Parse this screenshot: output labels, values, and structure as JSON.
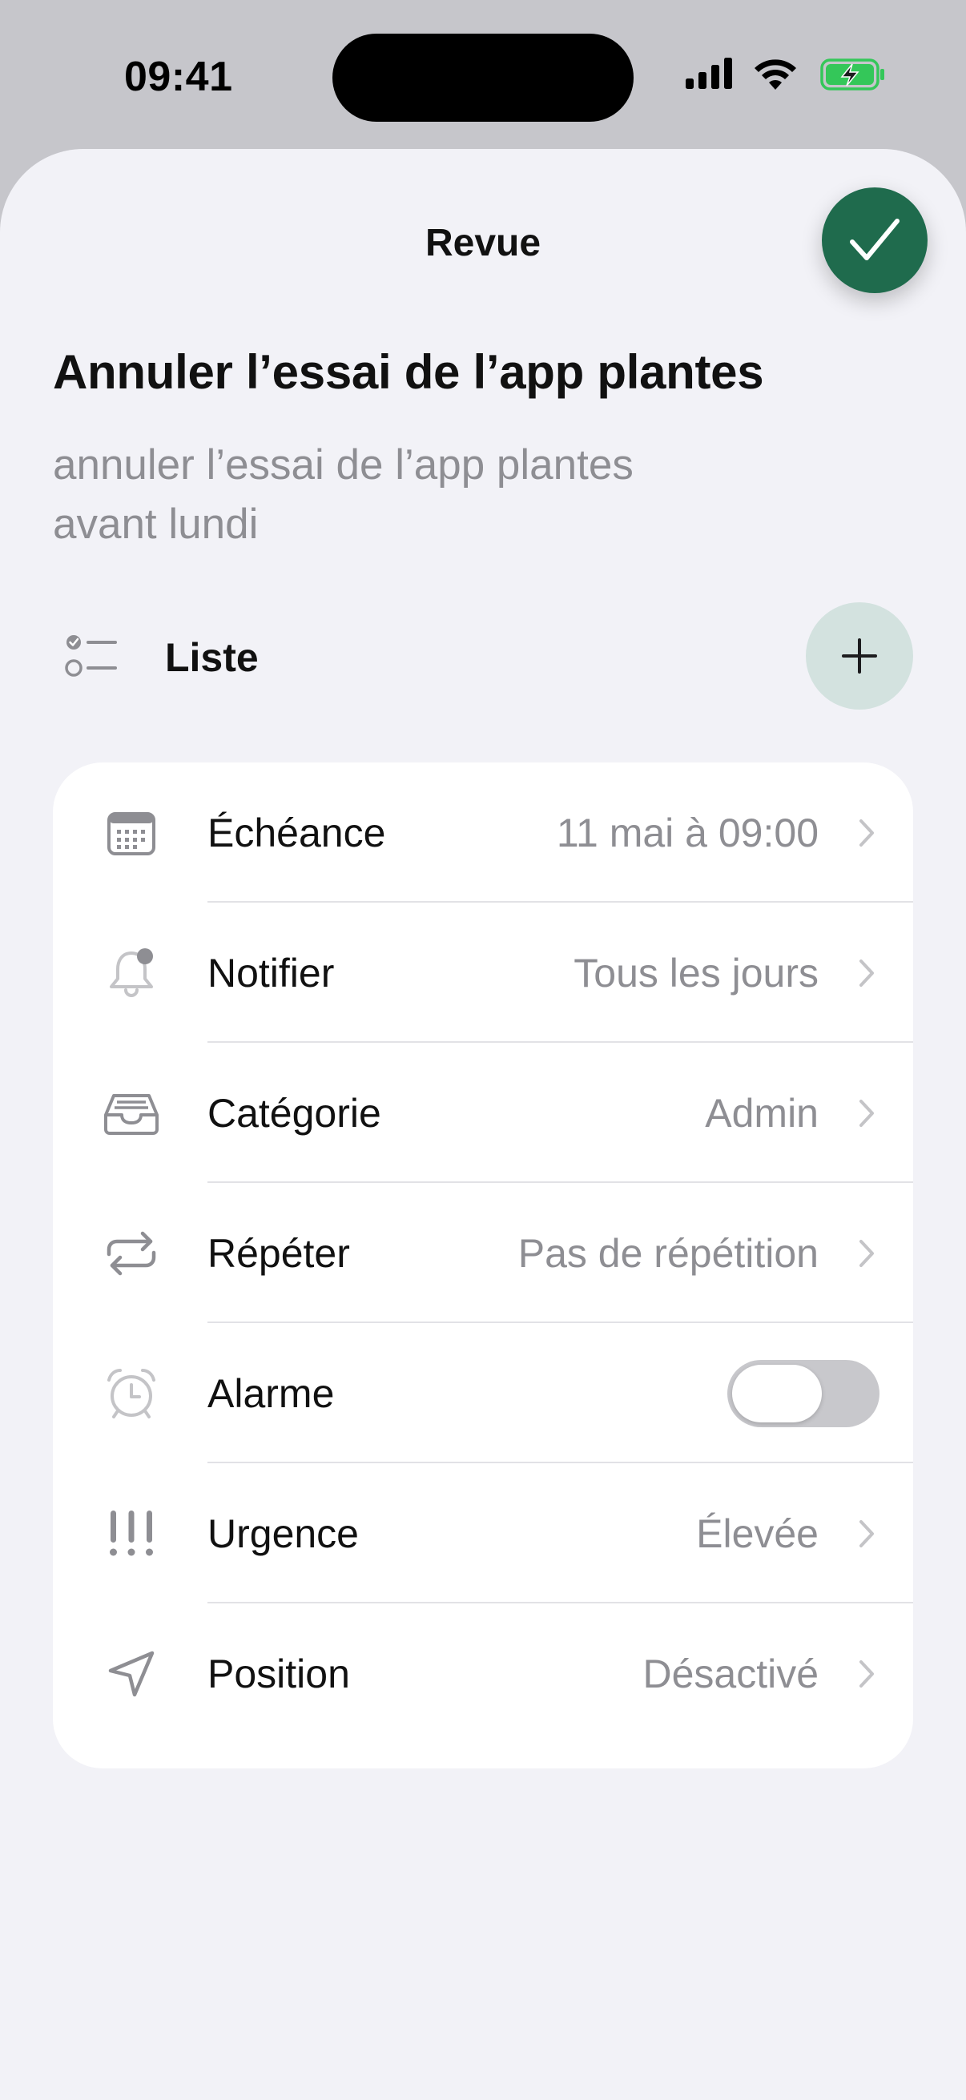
{
  "status_bar": {
    "time": "09:41",
    "icons": [
      "cellular-signal-icon",
      "wifi-icon",
      "battery-charging-icon"
    ],
    "battery_color": "#34c759"
  },
  "sheet": {
    "title": "Revue",
    "confirm_icon": "checkmark-icon",
    "accent_color": "#1f6b4d"
  },
  "task": {
    "title": "Annuler l’essai de l’app plantes",
    "description_line1": "annuler l’essai de l’app plantes",
    "description_line2": "avant lundi"
  },
  "checklist": {
    "label": "Liste",
    "icon": "checklist-icon",
    "add_icon": "plus-icon"
  },
  "details": {
    "due": {
      "label": "Échéance",
      "value": "11 mai à 09:00",
      "icon": "calendar-icon"
    },
    "notify": {
      "label": "Notifier",
      "value": "Tous les jours",
      "icon": "bell-icon"
    },
    "category": {
      "label": "Catégorie",
      "value": "Admin",
      "icon": "tray-icon"
    },
    "repeat": {
      "label": "Répéter",
      "value": "Pas de répétition",
      "icon": "repeat-icon"
    },
    "alarm": {
      "label": "Alarme",
      "enabled": false,
      "icon": "alarm-clock-icon"
    },
    "urgency": {
      "label": "Urgence",
      "value": "Élevée",
      "icon": "exclamation-icon"
    },
    "location": {
      "label": "Position",
      "value": "Désactivé",
      "icon": "location-arrow-icon"
    }
  }
}
